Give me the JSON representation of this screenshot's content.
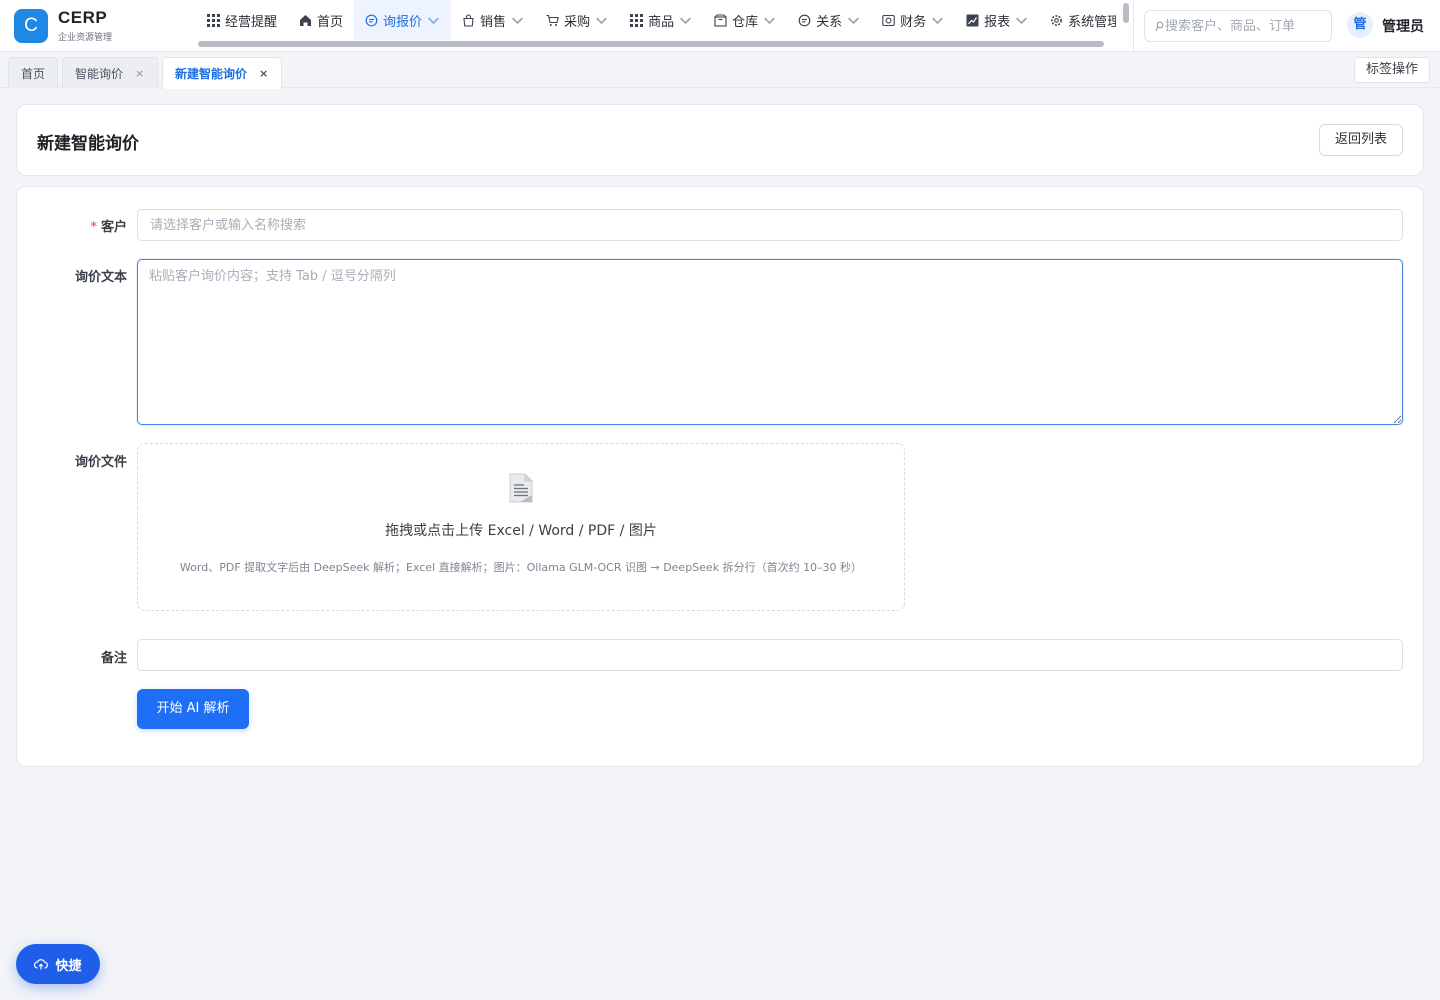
{
  "brand": {
    "logo_letter": "C",
    "title": "CERP",
    "subtitle": "企业资源管理"
  },
  "nav": {
    "items": [
      {
        "label": "经营提醒",
        "icon": "grid-icon",
        "has_dropdown": false
      },
      {
        "label": "首页",
        "icon": "home-icon",
        "has_dropdown": false
      },
      {
        "label": "询报价",
        "icon": "chat-icon",
        "has_dropdown": true,
        "active": true
      },
      {
        "label": "销售",
        "icon": "bag-icon",
        "has_dropdown": true
      },
      {
        "label": "采购",
        "icon": "cart-icon",
        "has_dropdown": true
      },
      {
        "label": "商品",
        "icon": "grid-icon",
        "has_dropdown": true
      },
      {
        "label": "仓库",
        "icon": "warehouse-icon",
        "has_dropdown": true
      },
      {
        "label": "关系",
        "icon": "chat-icon",
        "has_dropdown": true
      },
      {
        "label": "财务",
        "icon": "finance-icon",
        "has_dropdown": true
      },
      {
        "label": "报表",
        "icon": "chart-icon",
        "has_dropdown": true
      },
      {
        "label": "系统管理",
        "icon": "gear-icon",
        "has_dropdown": true
      }
    ]
  },
  "search": {
    "placeholder": "搜索客户、商品、订单"
  },
  "user": {
    "avatar_text": "管",
    "name": "管理员"
  },
  "tabs": {
    "items": [
      {
        "label": "首页",
        "closable": false
      },
      {
        "label": "智能询价",
        "closable": true
      },
      {
        "label": "新建智能询价",
        "closable": true,
        "active": true
      }
    ],
    "close_glyph": "×",
    "ops_label": "标签操作"
  },
  "page": {
    "title": "新建智能询价",
    "back_label": "返回列表"
  },
  "form": {
    "customer": {
      "label": "客户",
      "required_mark": "*",
      "placeholder": "请选择客户或输入名称搜索",
      "value": ""
    },
    "inquiry_text": {
      "label": "询价文本",
      "placeholder": "粘贴客户询价内容；支持 Tab / 逗号分隔列",
      "value": ""
    },
    "inquiry_file": {
      "label": "询价文件",
      "upload_title": "拖拽或点击上传 Excel / Word / PDF / 图片",
      "upload_hint": "Word、PDF 提取文字后由 DeepSeek 解析；Excel 直接解析；图片：Ollama GLM-OCR 识图 → DeepSeek 拆分行（首次约 10–30 秒）"
    },
    "remark": {
      "label": "备注",
      "value": ""
    },
    "submit_label": "开始 AI 解析"
  },
  "quick": {
    "label": "快捷"
  },
  "colors": {
    "primary": "#1e6ff5",
    "logo": "#1e88e5",
    "active_tab_text": "#1e6fe0",
    "required": "#e53935"
  }
}
